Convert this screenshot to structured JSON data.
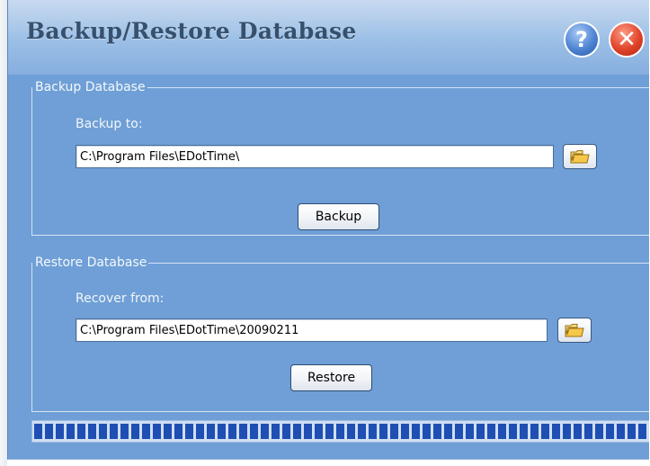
{
  "window": {
    "title": "Backup/Restore Database",
    "icons": [
      "help-icon",
      "close-icon"
    ],
    "help_glyph": "?",
    "close_glyph": "✕"
  },
  "backup": {
    "group_title": "Backup Database",
    "field_label": "Backup to:",
    "path_value": "C:\\Program Files\\EDotTime\\",
    "browse_icon": "folder-icon",
    "button_label": "Backup"
  },
  "restore": {
    "group_title": "Restore Database",
    "field_label": "Recover from:",
    "path_value": "C:\\Program Files\\EDotTime\\20090211",
    "browse_icon": "folder-icon",
    "button_label": "Restore"
  },
  "progress": {
    "percent": 100,
    "color": "#1f4fb3"
  },
  "colors": {
    "panel_background": "#6f9fd6",
    "title_text": "#37506e"
  }
}
